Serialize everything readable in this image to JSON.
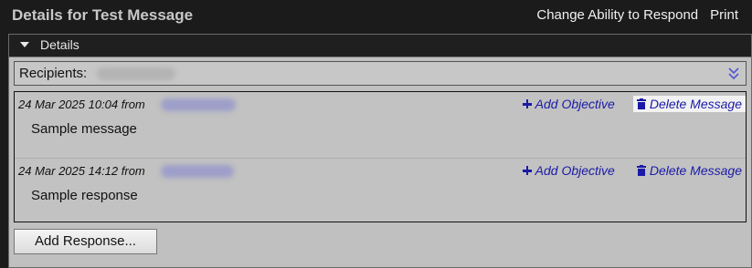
{
  "header": {
    "title": "Details for Test Message",
    "change_ability": "Change Ability to Respond",
    "print": "Print"
  },
  "panel": {
    "title": "Details",
    "recipients_label": "Recipients:"
  },
  "messages": [
    {
      "meta": "24 Mar 2025 10:04 from",
      "body": "Sample message",
      "add_objective": "Add Objective",
      "delete_message": "Delete Message"
    },
    {
      "meta": "24 Mar 2025 14:12 from",
      "body": "Sample response",
      "add_objective": "Add Objective",
      "delete_message": "Delete Message"
    }
  ],
  "add_response_label": "Add Response...",
  "icons": {
    "collapse": "caret-down-icon",
    "expand_recipients": "double-chevron-down-icon",
    "add": "plus-icon",
    "delete": "trash-icon"
  },
  "colors": {
    "link": "#1a1aa8",
    "header_bg": "#1b1b1b",
    "panel_bg": "#c0c0c0"
  }
}
